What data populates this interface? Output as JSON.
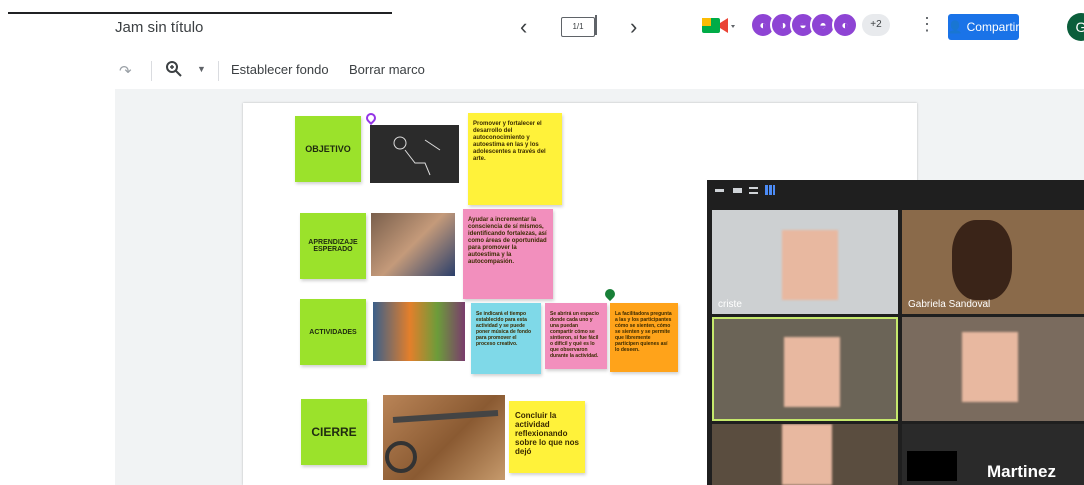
{
  "header": {
    "title": "Jam sin título",
    "frame_counter": "1/1",
    "prev_icon": "chevron-left-icon",
    "next_icon": "chevron-right-icon",
    "extra_participants": "+2",
    "share_label": "Compartir",
    "account_initial": "G"
  },
  "toolbar": {
    "redo_icon": "redo-icon",
    "zoom_icon": "zoom-icon",
    "set_background": "Establecer fondo",
    "clear_frame": "Borrar marco"
  },
  "board": {
    "labels": {
      "objetivo": "OBJETIVO",
      "aprendizaje": "APRENDIZAJE ESPERADO",
      "actividades": "ACTIVIDADES",
      "cierre": "CIERRE"
    },
    "notes": {
      "objetivo_text": "Promover y fortalecer el desarrollo del autoconocimiento y autoestima en las y los adolescentes a través del arte.",
      "aprendizaje_text": "Ayudar a incrementar la consciencia de sí mismos, identificando fortalezas, así como áreas de oportunidad para promover la autoestima y la autocompasión.",
      "actividad_1": "Se indicará el tiempo establecido para esta actividad y se puede poner música de fondo para promover el proceso creativo.",
      "actividad_2": "Se abrirá un espacio donde cada uno y una puedan compartir cómo se sintieron, si fue fácil o difícil y qué es lo que observaron durante la actividad.",
      "actividad_3": "La facilitadora pregunta a las y los participantes cómo se sienten, cómo se sienten y se permite que libremente participen quienes así lo deseen.",
      "cierre_text": "Concluir la actividad reflexionando sobre lo que nos dejó"
    }
  },
  "video": {
    "participants": [
      {
        "name": "criste",
        "tile": "top-left"
      },
      {
        "name": "Gabriela Sandoval",
        "tile": "top-right"
      },
      {
        "name": "",
        "tile": "middle-left"
      },
      {
        "name": "",
        "tile": "middle-right"
      },
      {
        "name": "",
        "tile": "bottom-left"
      },
      {
        "name": "Martinez",
        "tile": "bottom-right"
      }
    ]
  },
  "colors": {
    "accent": "#1a73e8",
    "note_green": "#9be22b",
    "note_yellow": "#fff23a",
    "note_pink": "#f28fbd",
    "note_cyan": "#7fd9e8",
    "note_orange": "#ffa31a",
    "avatar_purple": "#8e44d4"
  }
}
